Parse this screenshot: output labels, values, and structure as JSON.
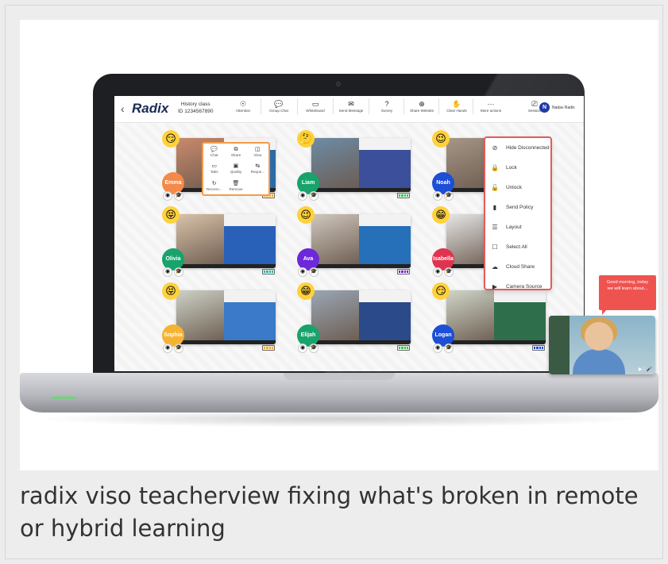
{
  "caption": "radix viso teacherview fixing what's broken in remote or hybrid learning",
  "app": {
    "back_glyph": "‹",
    "logo": "Radix",
    "class_name": "History class",
    "class_id": "ID 1234567890",
    "user_initial": "N",
    "user_name": "Nadav Radix"
  },
  "toolbar": [
    {
      "icon": "target-icon",
      "glyph": "☉",
      "label": "Attention"
    },
    {
      "icon": "chat-icon",
      "glyph": "💬",
      "label": "Group Chat"
    },
    {
      "icon": "whiteboard-icon",
      "glyph": "▭",
      "label": "Whiteboard"
    },
    {
      "icon": "envelope-icon",
      "glyph": "✉",
      "label": "Send Message"
    },
    {
      "icon": "question-icon",
      "glyph": "?",
      "label": "Survey"
    },
    {
      "icon": "globe-icon",
      "glyph": "⊕",
      "label": "Share Website"
    },
    {
      "icon": "hand-icon",
      "glyph": "✋",
      "label": "Clear Hands"
    },
    {
      "icon": "more-icon",
      "glyph": "···",
      "label": "More actions"
    },
    {
      "icon": "cast-icon",
      "glyph": "⎚",
      "label": "Session"
    }
  ],
  "students": [
    {
      "name": "Emma",
      "emoji": "😏",
      "color": "#f5894a",
      "cam": "#c98a6c",
      "screen": "#2b6aa6",
      "battery": "#f5a623"
    },
    {
      "name": "Liam",
      "emoji": "🤔",
      "color": "#17a36b",
      "cam": "#6e8ca6",
      "screen": "#3b4f9a",
      "battery": "#2ecc40"
    },
    {
      "name": "Noah",
      "emoji": "😉",
      "color": "#1c4fd6",
      "cam": "#a69686",
      "screen": "#3c7fc0",
      "battery": "#ff4d4d"
    },
    {
      "name": "Olivia",
      "emoji": "😝",
      "color": "#17a36b",
      "cam": "#d9c2a9",
      "screen": "#2a61b8",
      "battery": "#27b3a0"
    },
    {
      "name": "Ava",
      "emoji": "😉",
      "color": "#6d28d9",
      "cam": "#cfc7bd",
      "screen": "#2570b8",
      "battery": "#6d28d9"
    },
    {
      "name": "Isabella",
      "emoji": "😁",
      "color": "#e0334f",
      "cam": "#e6e6e6",
      "screen": "#2a6fc4",
      "battery": "#ff4d4d"
    },
    {
      "name": "Sophia",
      "emoji": "😝",
      "color": "#f6b331",
      "cam": "#cdd1c5",
      "screen": "#3a7ac8",
      "battery": "#f5a623"
    },
    {
      "name": "Elijah",
      "emoji": "😁",
      "color": "#17a36b",
      "cam": "#9aa6b4",
      "screen": "#2b4a8a",
      "battery": "#2ecc40"
    },
    {
      "name": "Logan",
      "emoji": "😏",
      "color": "#1c4fd6",
      "cam": "#cfd6c8",
      "screen": "#2f6e4a",
      "battery": "#1c4fd6"
    }
  ],
  "popup": [
    {
      "icon": "chat-icon",
      "glyph": "💬",
      "label": "Chat"
    },
    {
      "icon": "share-icon",
      "glyph": "⧉",
      "label": "Share"
    },
    {
      "icon": "view-icon",
      "glyph": "◫",
      "label": "View"
    },
    {
      "icon": "tabs-icon",
      "glyph": "▭",
      "label": "Tabs"
    },
    {
      "icon": "hd-icon",
      "glyph": "▣",
      "label": "Quality"
    },
    {
      "icon": "request-icon",
      "glyph": "⇆",
      "label": "Reque..."
    },
    {
      "icon": "reconnect-icon",
      "glyph": "↻",
      "label": "Reconn..."
    },
    {
      "icon": "trash-icon",
      "glyph": "🗑",
      "label": "Remove"
    }
  ],
  "menu": [
    {
      "icon": "eye-off-icon",
      "glyph": "⊘",
      "label": "Hide Disconnected"
    },
    {
      "icon": "lock-icon",
      "glyph": "🔒",
      "label": "Lock"
    },
    {
      "icon": "unlock-icon",
      "glyph": "🔓",
      "label": "Unlock"
    },
    {
      "icon": "bookmark-icon",
      "glyph": "▮",
      "label": "Send Policy"
    },
    {
      "icon": "layout-icon",
      "glyph": "☰",
      "label": "Layout"
    },
    {
      "icon": "checkbox-icon",
      "glyph": "☐",
      "label": "Select All"
    },
    {
      "icon": "cloud-icon",
      "glyph": "☁",
      "label": "Cloud Share"
    },
    {
      "icon": "camera-icon",
      "glyph": "▶",
      "label": "Camera Source"
    }
  ],
  "bubble": "Good morning, today we will learn about...",
  "teacher_controls": "▶ ⁞ 🎤"
}
